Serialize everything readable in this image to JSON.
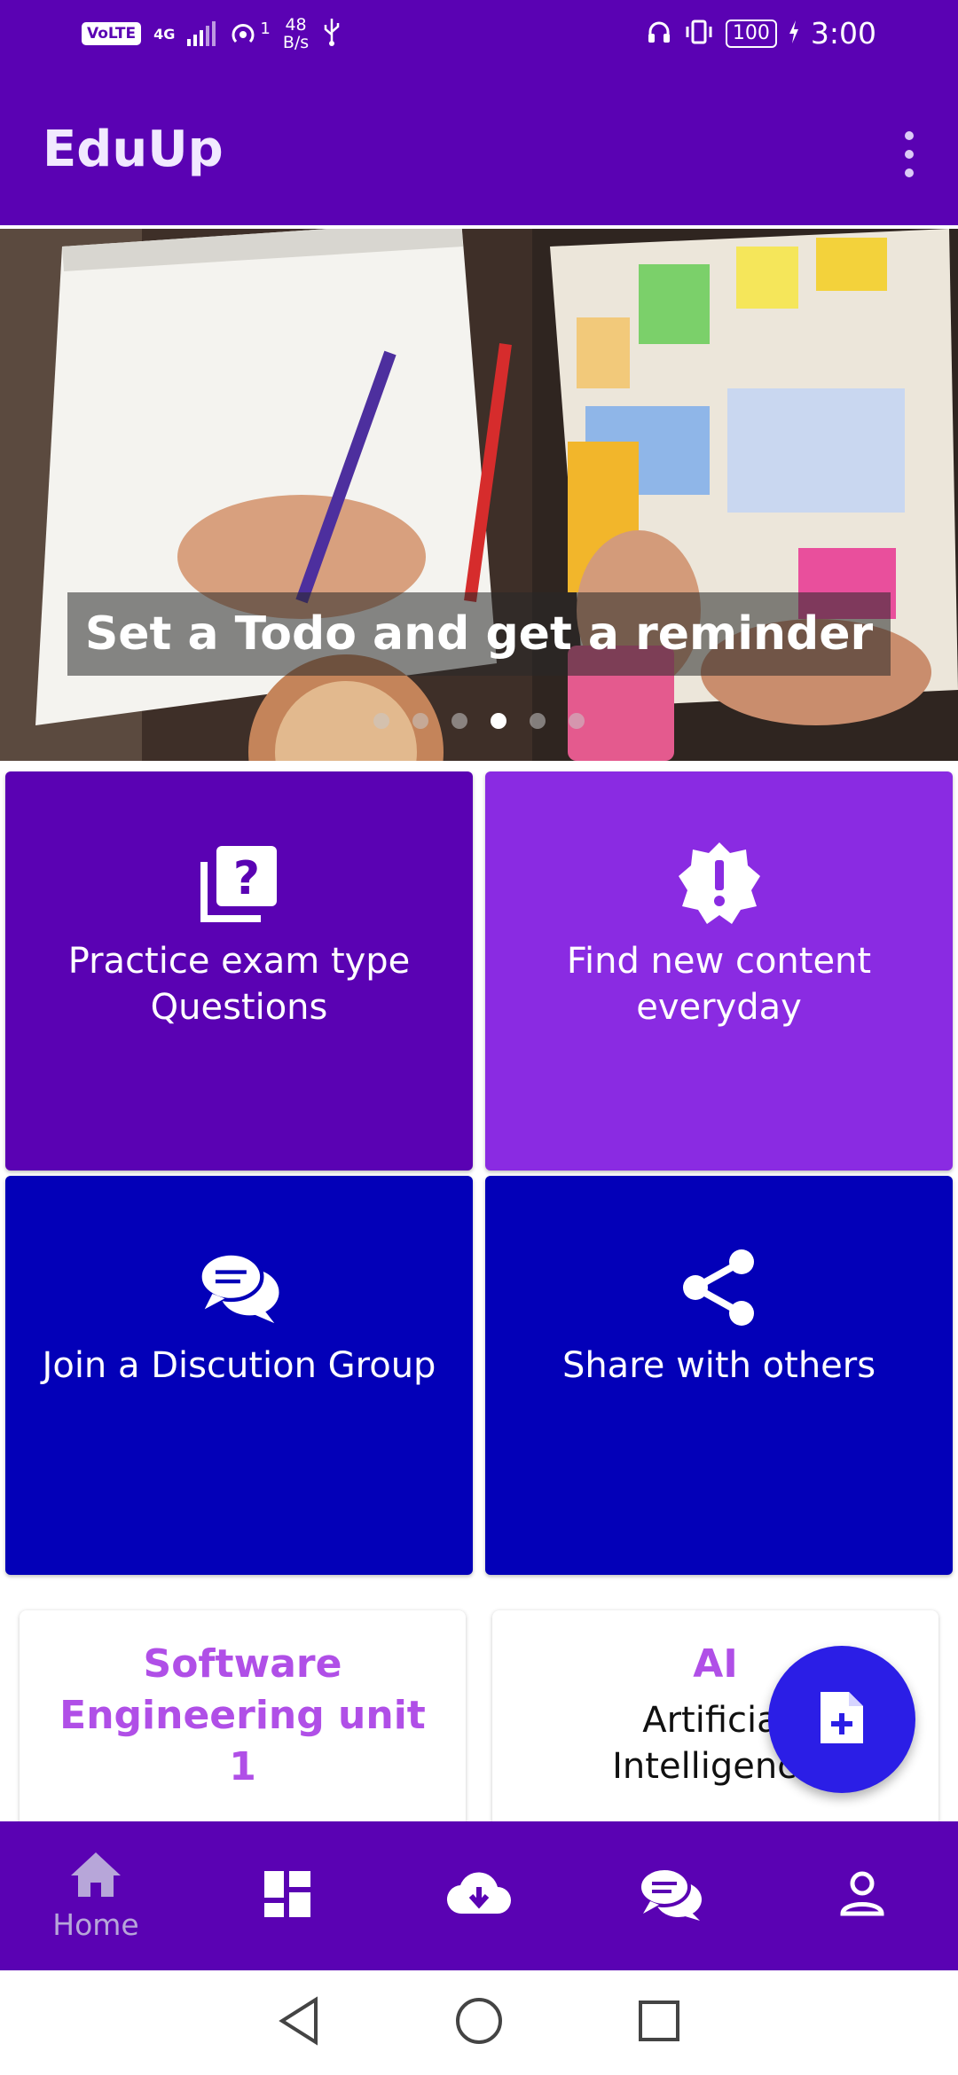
{
  "status_bar": {
    "network": "VoLTE",
    "network_type": "4G",
    "hotspot_count": "1",
    "speed_value": "48",
    "speed_unit": "B/s",
    "battery": "100",
    "time": "3:00"
  },
  "app_bar": {
    "title": "EduUp"
  },
  "banner": {
    "caption": "Set a Todo and get a reminder",
    "slide_count": 6,
    "active_slide": 4
  },
  "tiles": [
    {
      "label": "Practice exam type Questions",
      "icon": "quiz-icon",
      "color": "#5a02b3"
    },
    {
      "label": "Find new content everyday",
      "icon": "new-releases-icon",
      "color": "#8a2be2"
    },
    {
      "label": "Join a Discution Group",
      "icon": "forum-icon",
      "color": "#0300b8"
    },
    {
      "label": "Share with others",
      "icon": "share-icon",
      "color": "#0300b8"
    }
  ],
  "cards": [
    {
      "title": "Software Engineering unit 1",
      "subtitle": ""
    },
    {
      "title": "AI",
      "subtitle": "Artificial Intelligence"
    }
  ],
  "fab": {
    "icon": "note-add-icon"
  },
  "bottom_nav": {
    "items": [
      {
        "icon": "home-icon",
        "label": "Home"
      },
      {
        "icon": "dashboard-icon",
        "label": ""
      },
      {
        "icon": "cloud-download-icon",
        "label": ""
      },
      {
        "icon": "chat-icon",
        "label": ""
      },
      {
        "icon": "person-icon",
        "label": ""
      }
    ]
  },
  "colors": {
    "primary": "#5a02b3",
    "accent": "#8a2be2",
    "blue": "#0300b8",
    "fab": "#2b1ee6",
    "card_title": "#b04fe7"
  }
}
